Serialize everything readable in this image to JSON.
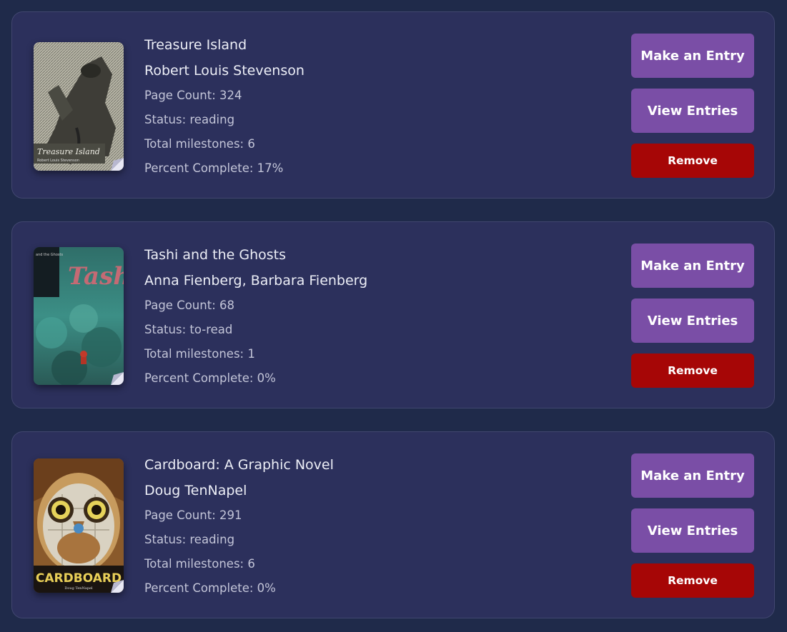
{
  "books": [
    {
      "title": "Treasure Island",
      "author": "Robert Louis Stevenson",
      "page_count": "Page Count: 324",
      "status": "Status: reading",
      "milestones": "Total milestones: 6",
      "percent": "Percent Complete: 17%",
      "cover_text": "Treasure Island",
      "cover_subtext": "Robert Louis Stevenson",
      "make_entry_label": "Make an Entry",
      "view_entries_label": "View Entries",
      "remove_label": "Remove"
    },
    {
      "title": "Tashi and the Ghosts",
      "author": "Anna Fienberg, Barbara Fienberg",
      "page_count": "Page Count: 68",
      "status": "Status: to-read",
      "milestones": "Total milestones: 1",
      "percent": "Percent Complete: 0%",
      "cover_text": "Tashi",
      "cover_subtext": "and the Ghosts",
      "make_entry_label": "Make an Entry",
      "view_entries_label": "View Entries",
      "remove_label": "Remove"
    },
    {
      "title": "Cardboard: A Graphic Novel",
      "author": "Doug TenNapel",
      "page_count": "Page Count: 291",
      "status": "Status: reading",
      "milestones": "Total milestones: 6",
      "percent": "Percent Complete: 0%",
      "cover_text": "CARDBOARD",
      "cover_subtext": "Doug TenNapel",
      "make_entry_label": "Make an Entry",
      "view_entries_label": "View Entries",
      "remove_label": "Remove"
    }
  ],
  "colors": {
    "page_bg": "#1f2a4a",
    "card_bg": "#2c305c",
    "primary_button": "#7a4ea6",
    "danger_button": "#a60606"
  }
}
